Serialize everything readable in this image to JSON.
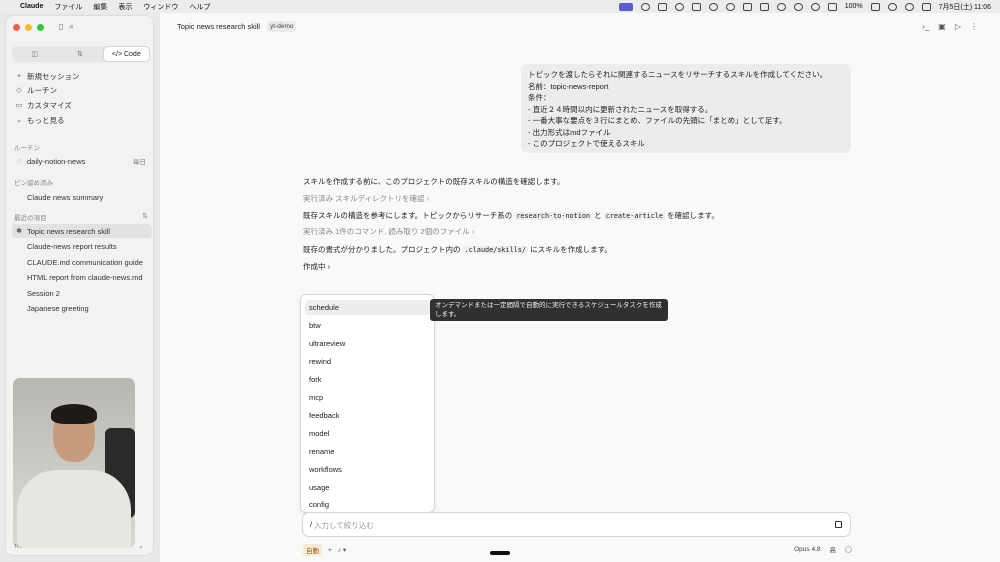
{
  "menubar": {
    "app": "Claude",
    "menus": [
      "ファイル",
      "編集",
      "表示",
      "ウィンドウ",
      "ヘルプ"
    ],
    "battery": "100%",
    "datetime": "7月5日(土) 11:06"
  },
  "sidebar": {
    "tabs": [
      "",
      "",
      "Code"
    ],
    "actions": [
      {
        "icon": "+",
        "label": "新規セッション"
      },
      {
        "icon": "◇",
        "label": "ルーチン"
      },
      {
        "icon": "▭",
        "label": "カスタマイズ"
      },
      {
        "icon": "⌄",
        "label": "もっと見る"
      }
    ],
    "routines_heading": "ルーチン",
    "routine": {
      "label": "daily-notion-news",
      "badge": "毎日"
    },
    "pinned_heading": "ピン留め済み",
    "pinned": "Claude news summary",
    "recent_heading": "最近の項目",
    "recent": [
      "Topic news research skill",
      "Claude-news report results",
      "CLAUDE.md communication guide",
      "HTML report from claude-news.md",
      "Session 2",
      "Japanese greeting"
    ],
    "webcam_caption": "Tr..."
  },
  "header": {
    "title": "Topic news research skill",
    "repo": "yt-demo"
  },
  "conversation": {
    "user_lines": [
      "トピックを渡したらそれに関連するニュースをリサーチするスキルを作成してください。",
      "名前：topic-news-report",
      "条件：",
      "- 直近２４時間以内に更新されたニュースを取得する。",
      "- 一番大事な要点を３行にまとめ、ファイルの先頭に「まとめ」として足す。",
      "- 出力形式はmdファイル",
      "- このプロジェクトで使えるスキル"
    ],
    "a1": "スキルを作成する前に、このプロジェクトの既存スキルの構造を確認します。",
    "a2": "実行済み スキルディレクトリを確認 ›",
    "a3_pre": "既存スキルの構造を参考にします。トピックからリサーチ系の ",
    "a3_code1": "research-to-notion",
    "a3_mid": " と ",
    "a3_code2": "create-article",
    "a3_post": " を確認します。",
    "a4": "実行済み 1件のコマンド, 読み取り 2個のファイル ›",
    "a5_pre": "既存の書式が分かりました。プロジェクト内の ",
    "a5_code": ".claude/skills/",
    "a5_post": " にスキルを作成します。",
    "a6": "作成中 ›"
  },
  "slash_menu": {
    "items": [
      "schedule",
      "btw",
      "ultrareview",
      "rewind",
      "fork",
      "mcp",
      "feedback",
      "model",
      "rename",
      "workflows",
      "usage",
      "config"
    ],
    "tooltip": "オンデマンドまたは一定間隔で自動的に実行できるスケジュールタスクを作成します。"
  },
  "composer": {
    "value": "/",
    "placeholder": "入力して絞り込む",
    "mode": "自動",
    "model": "Opus 4.8",
    "effort": "高"
  }
}
